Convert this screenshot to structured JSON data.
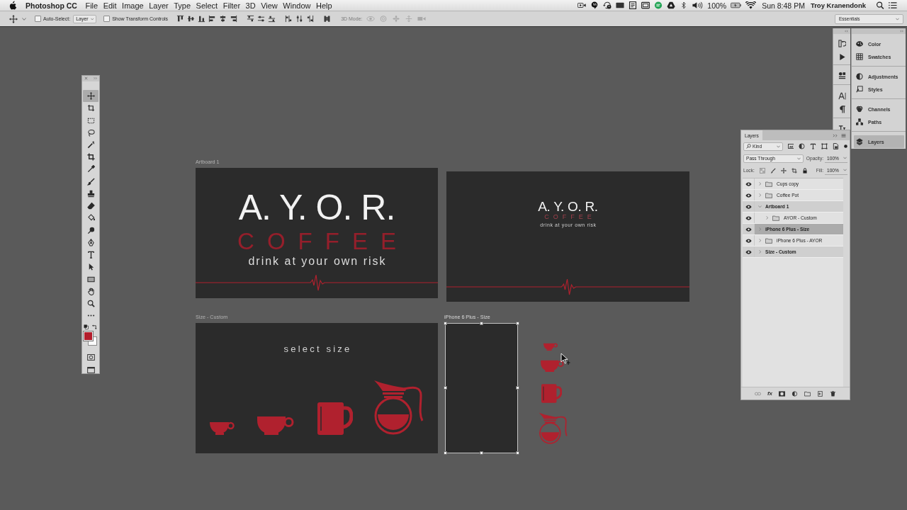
{
  "menu_bar": {
    "app_name": "Photoshop CC",
    "menus": [
      "File",
      "Edit",
      "Image",
      "Layer",
      "Type",
      "Select",
      "Filter",
      "3D",
      "View",
      "Window",
      "Help"
    ],
    "battery": "100%",
    "clock": "Sun 8:48 PM",
    "user": "Troy Kranendonk"
  },
  "options_bar": {
    "auto_select": {
      "label": "Auto-Select:",
      "checked": false
    },
    "auto_select_target": "Layer",
    "transform_controls": {
      "label": "Show Transform Controls",
      "checked": false
    },
    "mode_3d": {
      "label": "3D Mode:",
      "disabled": true
    },
    "workspace": "Essentials"
  },
  "toolbar": {
    "tools": [
      {
        "kind": "move",
        "selected": true
      },
      {
        "kind": "artboard",
        "selected": false
      },
      {
        "kind": "marquee",
        "selected": false
      },
      {
        "kind": "lasso",
        "selected": false
      },
      {
        "kind": "wand",
        "selected": false
      },
      {
        "kind": "crop",
        "selected": false
      },
      {
        "kind": "eyedropper",
        "selected": false
      },
      {
        "kind": "brush",
        "selected": false
      },
      {
        "kind": "stamp",
        "selected": false
      },
      {
        "kind": "eraser",
        "selected": false
      },
      {
        "kind": "bucket",
        "selected": false
      },
      {
        "kind": "dodge",
        "selected": false
      },
      {
        "kind": "pen",
        "selected": false
      },
      {
        "kind": "type",
        "selected": false
      },
      {
        "kind": "select",
        "selected": false
      },
      {
        "kind": "rectangle",
        "selected": false
      },
      {
        "kind": "hand",
        "selected": false
      },
      {
        "kind": "zoom",
        "selected": false
      },
      {
        "kind": "more",
        "selected": false
      }
    ]
  },
  "panel_dock": {
    "groups": [
      {
        "items": [
          {
            "label": "Color",
            "kind": "color",
            "selected": false
          },
          {
            "label": "Swatches",
            "kind": "swatches",
            "selected": false
          }
        ]
      },
      {
        "items": [
          {
            "label": "Adjustments",
            "kind": "adjustments",
            "selected": false
          },
          {
            "label": "Styles",
            "kind": "styles",
            "selected": false
          }
        ]
      },
      {
        "items": [
          {
            "label": "Channels",
            "kind": "channels",
            "selected": false
          },
          {
            "label": "Paths",
            "kind": "paths",
            "selected": false
          }
        ]
      },
      {
        "items": [
          {
            "label": "Layers",
            "kind": "layers",
            "selected": true
          }
        ]
      }
    ]
  },
  "layers_panel": {
    "title": "Layers",
    "filter": "Kind",
    "blend_mode": "Pass Through",
    "opacity_label": "Opacity:",
    "opacity": "100%",
    "lock_label": "Lock:",
    "fill_label": "Fill:",
    "fill": "100%",
    "effects_button": "fx",
    "layers": [
      {
        "name": "Cups copy",
        "kind": "group",
        "visible": true,
        "expanded": false,
        "selected": false
      },
      {
        "name": "Coffee Pot",
        "kind": "group",
        "visible": true,
        "expanded": false,
        "selected": false
      },
      {
        "name": "Artboard 1",
        "kind": "artboard",
        "visible": true,
        "expanded": true,
        "selected": false,
        "children": [
          {
            "name": "AYOR - Custom",
            "kind": "group",
            "visible": true,
            "expanded": false,
            "selected": false
          }
        ]
      },
      {
        "name": "iPhone 6 Plus - Size",
        "kind": "artboard",
        "visible": true,
        "expanded": false,
        "selected": true
      },
      {
        "name": "iPhone 6 Plus - AYOR",
        "kind": "group",
        "visible": true,
        "expanded": false,
        "selected": false
      },
      {
        "name": "Size - Custom",
        "kind": "artboard",
        "visible": true,
        "expanded": false,
        "selected": false
      }
    ]
  },
  "canvas": {
    "artboards": [
      {
        "label": "Artboard 1",
        "kind": "logo",
        "compact": false,
        "title": "A. Y. O. R.",
        "subtitle": "COFFEE",
        "tagline": "drink at your own risk",
        "selected": false
      },
      {
        "kind": "logo",
        "compact": true,
        "title": "A. Y. O. R.",
        "subtitle": "COFFEE",
        "tagline": "drink at your own risk",
        "selected": false
      },
      {
        "label": "Size - Custom",
        "kind": "sizes",
        "heading": "select size",
        "selected": false
      },
      {
        "label": "iPhone 6 Plus - Size",
        "kind": "blank",
        "selected": true
      }
    ]
  }
}
